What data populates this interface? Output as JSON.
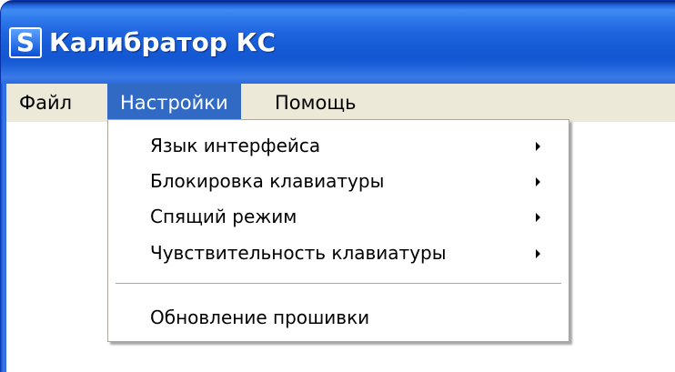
{
  "window": {
    "title": "Калибратор КС",
    "icon_glyph": "S",
    "icon_name": "app-s-icon"
  },
  "menubar": {
    "items": [
      {
        "label": "Файл"
      },
      {
        "label": "Настройки",
        "active": true
      },
      {
        "label": "Помощь"
      }
    ]
  },
  "settings_menu": {
    "items": [
      {
        "label": "Язык интерфейса",
        "submenu": true
      },
      {
        "label": "Блокировка клавиатуры",
        "submenu": true
      },
      {
        "label": "Спящий режим",
        "submenu": true
      },
      {
        "label": "Чувствительность клавиатуры",
        "submenu": true
      }
    ],
    "after_separator": [
      {
        "label": "Обновление прошивки",
        "submenu": false
      }
    ]
  },
  "colors": {
    "titlebar": "#2a68dd",
    "menubar_bg": "#ece9d8",
    "highlight": "#316ac5",
    "menu_border": "#aca899"
  }
}
